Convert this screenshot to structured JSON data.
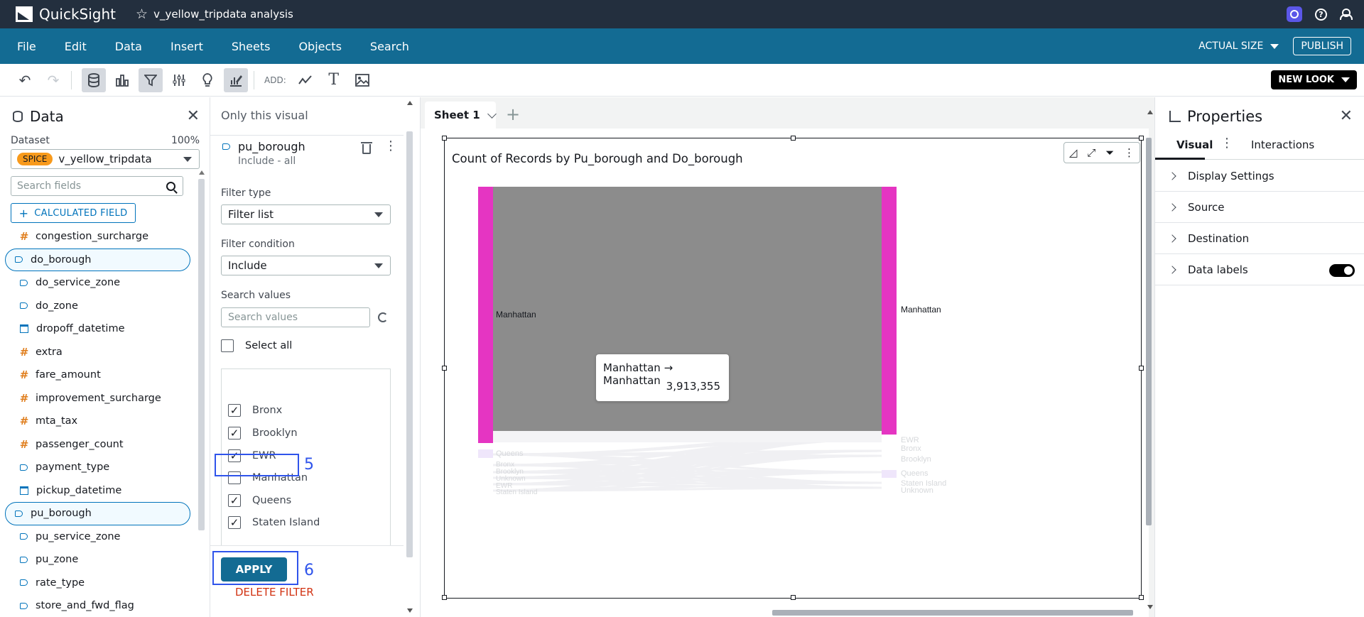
{
  "app": {
    "brand": "QuickSight",
    "analysis_title": "v_yellow_tripdata analysis"
  },
  "menu": [
    "File",
    "Edit",
    "Data",
    "Insert",
    "Sheets",
    "Objects",
    "Search"
  ],
  "menu_right": {
    "actual_size": "ACTUAL SIZE",
    "publish": "PUBLISH"
  },
  "toolbar": {
    "add_label": "ADD:",
    "new_look": "NEW LOOK"
  },
  "data_panel": {
    "title": "Data",
    "dataset_label": "Dataset",
    "dataset_pct": "100%",
    "spice_badge": "SPICE",
    "dataset_name": "v_yellow_tripdata",
    "search_placeholder": "Search fields",
    "calculated_field": "CALCULATED FIELD",
    "fields": [
      {
        "name": "congestion_surcharge",
        "type": "measure",
        "selected": false
      },
      {
        "name": "do_borough",
        "type": "dimension",
        "selected": true
      },
      {
        "name": "do_service_zone",
        "type": "dimension",
        "selected": false
      },
      {
        "name": "do_zone",
        "type": "dimension",
        "selected": false
      },
      {
        "name": "dropoff_datetime",
        "type": "date",
        "selected": false
      },
      {
        "name": "extra",
        "type": "measure",
        "selected": false
      },
      {
        "name": "fare_amount",
        "type": "measure",
        "selected": false
      },
      {
        "name": "improvement_surcharge",
        "type": "measure",
        "selected": false
      },
      {
        "name": "mta_tax",
        "type": "measure",
        "selected": false
      },
      {
        "name": "passenger_count",
        "type": "measure",
        "selected": false
      },
      {
        "name": "payment_type",
        "type": "dimension",
        "selected": false
      },
      {
        "name": "pickup_datetime",
        "type": "date",
        "selected": false
      },
      {
        "name": "pu_borough",
        "type": "dimension",
        "selected": true
      },
      {
        "name": "pu_service_zone",
        "type": "dimension",
        "selected": false
      },
      {
        "name": "pu_zone",
        "type": "dimension",
        "selected": false
      },
      {
        "name": "rate_type",
        "type": "dimension",
        "selected": false
      },
      {
        "name": "store_and_fwd_flag",
        "type": "dimension",
        "selected": false
      }
    ]
  },
  "filter_panel": {
    "header": "Only this visual",
    "field_name": "pu_borough",
    "field_sub": "Include - all",
    "filter_type_label": "Filter type",
    "filter_type_value": "Filter list",
    "filter_condition_label": "Filter condition",
    "filter_condition_value": "Include",
    "search_values_label": "Search values",
    "search_values_placeholder": "Search values",
    "select_all": "Select all",
    "values": [
      {
        "label": "Bronx",
        "checked": true
      },
      {
        "label": "Brooklyn",
        "checked": true
      },
      {
        "label": "EWR",
        "checked": true
      },
      {
        "label": "Manhattan",
        "checked": false
      },
      {
        "label": "Queens",
        "checked": true
      },
      {
        "label": "Staten Island",
        "checked": true
      }
    ],
    "apply": "APPLY",
    "delete_filter": "DELETE FILTER",
    "annotation_5": "5",
    "annotation_6": "6"
  },
  "canvas": {
    "sheet_tab": "Sheet 1",
    "visual_title": "Count of Records by Pu_borough and Do_borough",
    "tooltip_flow": "Manhattan → Manhattan",
    "tooltip_value": "3,913,355"
  },
  "chart_data": {
    "type": "sankey",
    "title": "Count of Records by Pu_borough and Do_borough",
    "source_nodes": [
      "Manhattan",
      "Queens",
      "Bronx",
      "Brooklyn",
      "Unknown",
      "EWR",
      "Staten Island"
    ],
    "destination_nodes": [
      "Manhattan",
      "EWR",
      "Bronx",
      "Brooklyn",
      "Queens",
      "Staten Island",
      "Unknown"
    ],
    "highlighted_flow": {
      "source": "Manhattan",
      "target": "Manhattan",
      "value": 3913355
    },
    "colors": {
      "node": "#e535c2",
      "highlight_flow": "#8c8c8c"
    }
  },
  "properties": {
    "title": "Properties",
    "tab_visual": "Visual",
    "tab_interactions": "Interactions",
    "sections": [
      "Display Settings",
      "Source",
      "Destination",
      "Data labels"
    ],
    "data_labels_on": true
  }
}
